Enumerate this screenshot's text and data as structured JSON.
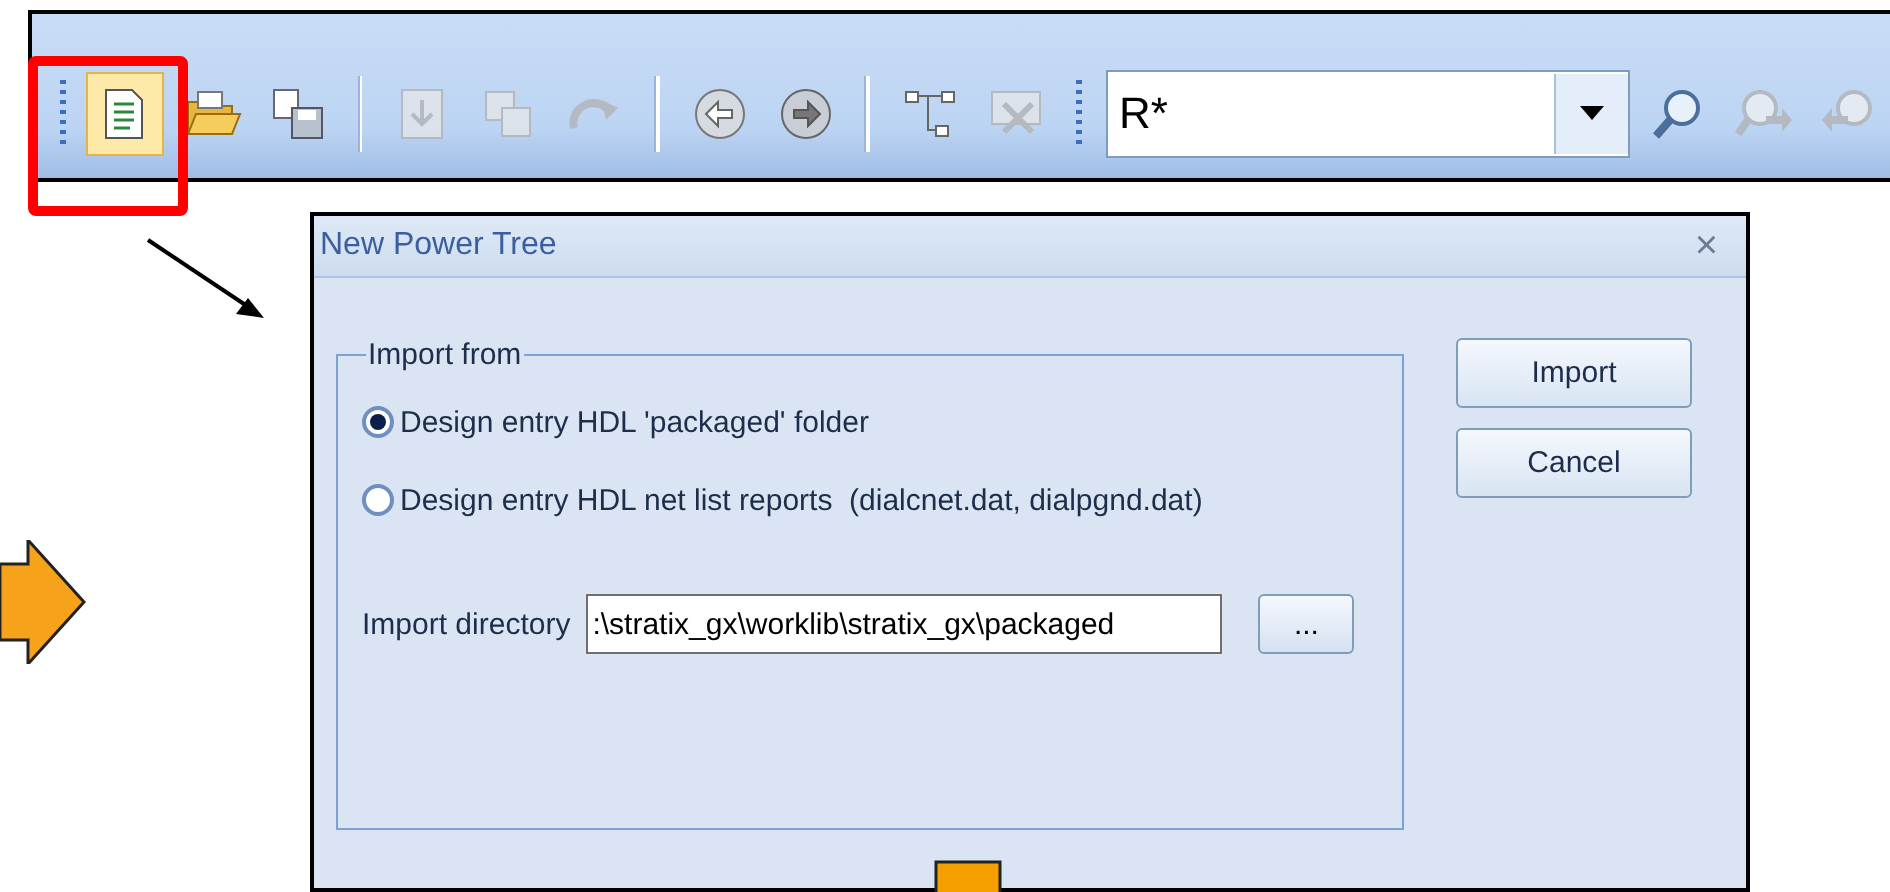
{
  "toolbar": {
    "buttons": [
      {
        "kind": "new",
        "disabled": false,
        "highlighted": true
      },
      {
        "kind": "open",
        "disabled": false,
        "highlighted": false
      },
      {
        "kind": "save",
        "disabled": false,
        "highlighted": false
      },
      {
        "kind": "sep"
      },
      {
        "kind": "import",
        "disabled": true,
        "highlighted": false
      },
      {
        "kind": "copy",
        "disabled": true,
        "highlighted": false
      },
      {
        "kind": "redo",
        "disabled": true,
        "highlighted": false
      },
      {
        "kind": "sep"
      },
      {
        "kind": "back",
        "disabled": false,
        "highlighted": false
      },
      {
        "kind": "forward",
        "disabled": false,
        "highlighted": false
      },
      {
        "kind": "sep"
      },
      {
        "kind": "tree",
        "disabled": false,
        "highlighted": false
      },
      {
        "kind": "remove",
        "disabled": true,
        "highlighted": false
      }
    ],
    "search_value": "R*",
    "search_buttons": [
      {
        "kind": "find",
        "disabled": false
      },
      {
        "kind": "next",
        "disabled": true
      },
      {
        "kind": "prev",
        "disabled": true
      }
    ]
  },
  "dialog": {
    "title": "New Power Tree",
    "close": "×",
    "group_title": "Import from",
    "options": [
      {
        "label": "Design entry HDL 'packaged' folder",
        "selected": true
      },
      {
        "label": "Design entry HDL net list reports  (dialcnet.dat, dialpgnd.dat)",
        "selected": false
      }
    ],
    "directory_label": "Import directory",
    "directory_value": ":\\stratix_gx\\worklib\\stratix_gx\\packaged",
    "browse": "...",
    "buttons": [
      "Import",
      "Cancel"
    ]
  }
}
